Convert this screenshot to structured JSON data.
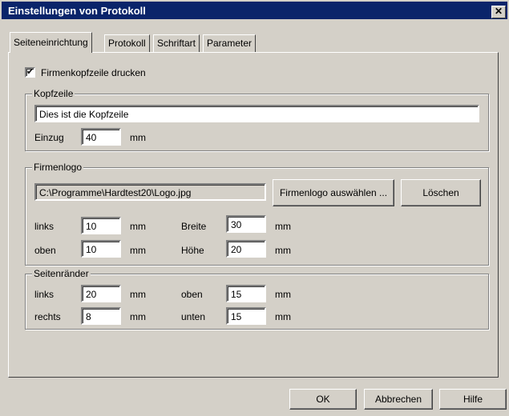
{
  "window": {
    "title": "Einstellungen von Protokoll",
    "close_glyph": "✕"
  },
  "tabs": [
    "Seiteneinrichtung",
    "Protokoll",
    "Schriftart",
    "Parameter"
  ],
  "print_header": {
    "label": "Firmenkopfzeile drucken",
    "checked": true,
    "check_glyph": "✔"
  },
  "header_group": {
    "title": "Kopfzeile",
    "text_value": "Dies ist die Kopfzeile",
    "indent_label": "Einzug",
    "indent_value": "40",
    "indent_unit": "mm"
  },
  "logo_group": {
    "title": "Firmenlogo",
    "path_value": "C:\\Programme\\Hardtest20\\Logo.jpg",
    "select_button": "Firmenlogo auswählen ...",
    "delete_button": "Löschen",
    "left_label": "links",
    "left_value": "10",
    "left_unit": "mm",
    "top_label": "oben",
    "top_value": "10",
    "top_unit": "mm",
    "width_label": "Breite",
    "width_value": "30",
    "width_unit": "mm",
    "height_label": "Höhe",
    "height_value": "20",
    "height_unit": "mm"
  },
  "margins_group": {
    "title": "Seitenränder",
    "left_label": "links",
    "left_value": "20",
    "left_unit": "mm",
    "right_label": "rechts",
    "right_value": "8",
    "right_unit": "mm",
    "top_label": "oben",
    "top_value": "15",
    "top_unit": "mm",
    "bottom_label": "unten",
    "bottom_value": "15",
    "bottom_unit": "mm"
  },
  "buttons": {
    "ok": "OK",
    "cancel": "Abbrechen",
    "help": "Hilfe"
  },
  "colors": {
    "titlebar": "#0a246a",
    "face": "#d4d0c8"
  }
}
